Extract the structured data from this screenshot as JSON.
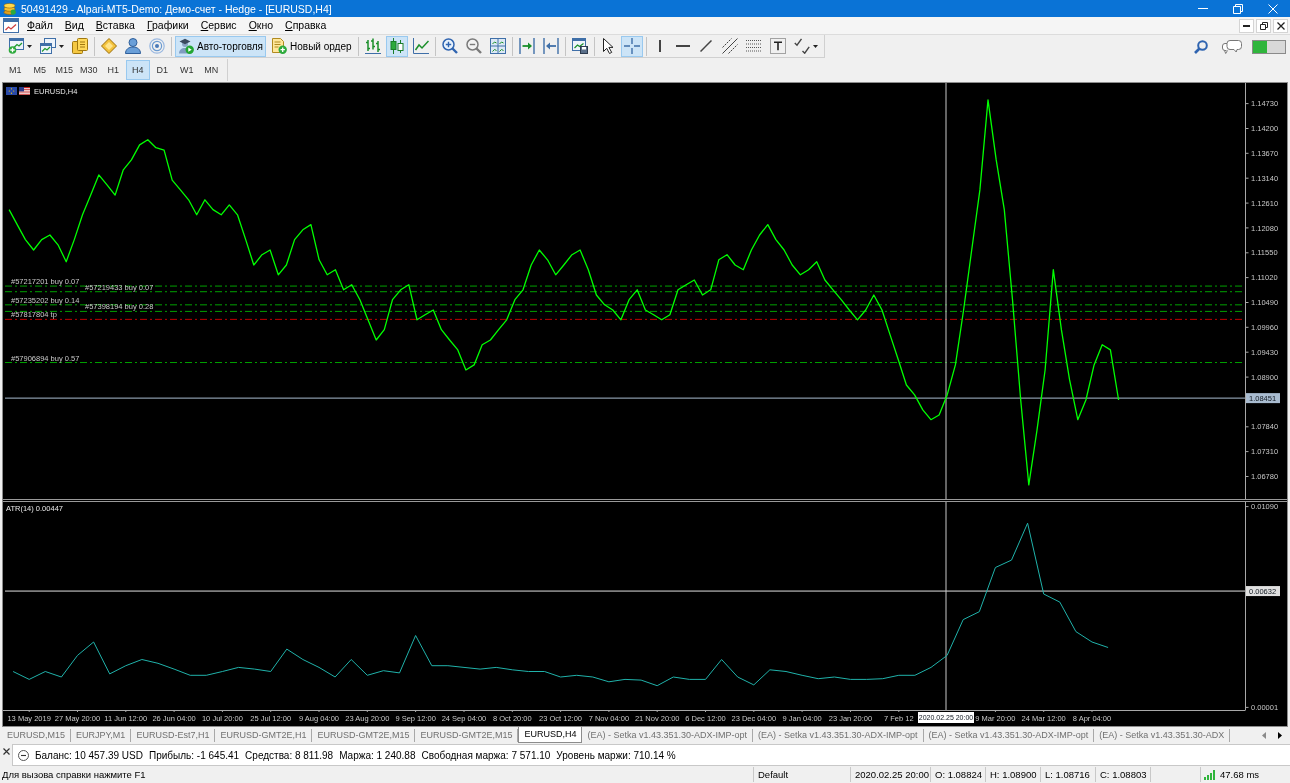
{
  "window": {
    "title": "50491429 - Alpari-MT5-Demo: Демо-счет - Hedge - [EURUSD,H4]"
  },
  "menu": [
    "Файл",
    "Вид",
    "Вставка",
    "Графики",
    "Сервис",
    "Окно",
    "Справка"
  ],
  "toolbar": {
    "auto_trading": {
      "label": "Авто-торговля",
      "on": true
    },
    "new_order": {
      "label": "Новый ордер"
    },
    "chart_types": [
      {
        "selected": false
      },
      {
        "selected": true
      },
      {
        "selected": false
      }
    ],
    "pointer_tools": [
      {
        "selected": false
      },
      {
        "selected": true
      }
    ]
  },
  "timeframes": [
    {
      "label": "M1",
      "selected": false
    },
    {
      "label": "M5",
      "selected": false
    },
    {
      "label": "M15",
      "selected": false
    },
    {
      "label": "M30",
      "selected": false
    },
    {
      "label": "H1",
      "selected": false
    },
    {
      "label": "H4",
      "selected": true
    },
    {
      "label": "D1",
      "selected": false
    },
    {
      "label": "W1",
      "selected": false
    },
    {
      "label": "MN",
      "selected": false
    }
  ],
  "chart": {
    "crosshair": {
      "time_label": "2020.02.25 20:00"
    },
    "chart_data": [
      {
        "type": "line",
        "title": "EURUSD,H4",
        "values": [
          1.1247,
          1.1215,
          1.1183,
          1.1161,
          1.1183,
          1.1193,
          1.1172,
          1.1136,
          1.1183,
          1.1236,
          1.1278,
          1.1321,
          1.13,
          1.1278,
          1.1332,
          1.1353,
          1.1385,
          1.1396,
          1.1379,
          1.1374,
          1.131,
          1.1289,
          1.1268,
          1.1236,
          1.1268,
          1.1247,
          1.1236,
          1.1257,
          1.1236,
          1.1183,
          1.1129,
          1.1151,
          1.1161,
          1.1108,
          1.1129,
          1.1183,
          1.1204,
          1.1215,
          1.114,
          1.1108,
          1.1119,
          1.1076,
          1.1087,
          1.1055,
          1.1012,
          1.0969,
          1.0991,
          1.1055,
          1.1076,
          1.1087,
          1.1012,
          1.1023,
          1.1033,
          1.0991,
          1.0969,
          1.0948,
          1.0905,
          1.0916,
          1.0959,
          1.0969,
          1.0991,
          1.1012,
          1.1055,
          1.1076,
          1.1129,
          1.1161,
          1.114,
          1.1108,
          1.1129,
          1.1151,
          1.1161,
          1.1119,
          1.1065,
          1.1044,
          1.1033,
          1.1012,
          1.1055,
          1.1076,
          1.1033,
          1.1023,
          1.1012,
          1.1023,
          1.1076,
          1.1087,
          1.1097,
          1.1065,
          1.1076,
          1.114,
          1.1151,
          1.1129,
          1.1119,
          1.1161,
          1.1193,
          1.1215,
          1.1183,
          1.1161,
          1.1129,
          1.1108,
          1.1119,
          1.1136,
          1.1097,
          1.1076,
          1.1055,
          1.1033,
          1.1012,
          1.1033,
          1.1065,
          1.1033,
          1.098,
          1.0927,
          1.0873,
          1.0852,
          1.082,
          1.0799,
          1.0809,
          1.0852,
          1.0916,
          1.1033,
          1.1161,
          1.1289,
          1.1481,
          1.1353,
          1.1247,
          1.1055,
          1.0841,
          1.066,
          1.0777,
          1.0905,
          1.1119,
          1.0991,
          1.0884,
          1.0799,
          1.0841,
          1.0916,
          1.0959,
          1.0948,
          1.0841,
          null,
          null,
          null,
          null,
          null,
          null,
          null,
          null,
          null,
          null,
          null,
          null,
          null,
          null,
          null
        ],
        "color": "#00ff00",
        "ylim": [
          1.063,
          1.1517
        ],
        "yticks": [
          {
            "value": 1.1473,
            "label": "1.14730"
          },
          {
            "value": 1.142,
            "label": "1.14200"
          },
          {
            "value": 1.1367,
            "label": "1.13670"
          },
          {
            "value": 1.1314,
            "label": "1.13140"
          },
          {
            "value": 1.1261,
            "label": "1.12610"
          },
          {
            "value": 1.1208,
            "label": "1.12080"
          },
          {
            "value": 1.1155,
            "label": "1.11550"
          },
          {
            "value": 1.1102,
            "label": "1.11020"
          },
          {
            "value": 1.1049,
            "label": "1.10490"
          },
          {
            "value": 1.0996,
            "label": "1.09960"
          },
          {
            "value": 1.0943,
            "label": "1.09430"
          },
          {
            "value": 1.089,
            "label": "1.08900"
          },
          {
            "value": 1.0784,
            "label": "1.07840"
          },
          {
            "value": 1.0731,
            "label": "1.07310"
          },
          {
            "value": 1.0678,
            "label": "1.06780"
          }
        ],
        "tick_labels": "y",
        "ref_lines": [
          {
            "axis": "y",
            "value": 1.1084,
            "label": "#57217201 buy 0.07",
            "color": "#00a000",
            "line_style": "dashdot"
          },
          {
            "axis": "y",
            "value": 1.1072,
            "label": "#57219433 buy 0.07",
            "color": "#00a000",
            "line_style": "dashdot"
          },
          {
            "axis": "y",
            "value": 1.1044,
            "label": "#57235202 buy 0.14",
            "color": "#00a000",
            "line_style": "dashdot"
          },
          {
            "axis": "y",
            "value": 1.103,
            "label": "#57398194 buy 0.28",
            "color": "#00a000",
            "line_style": "dashdot"
          },
          {
            "axis": "y",
            "value": 1.1013,
            "label": "#57817804 tp",
            "color": "#c00000",
            "line_style": "dashdot"
          },
          {
            "axis": "y",
            "value": 1.0921,
            "label": "#57906894 buy 0.57",
            "color": "#00a000",
            "line_style": "dashdot"
          },
          {
            "axis": "y",
            "value": 1.08451,
            "label": "1.08451",
            "color": "#a9bcd0",
            "line_style": "solid"
          }
        ]
      },
      {
        "type": "line",
        "title": "ATR(14) 0.00447",
        "categories": [
          null,
          "13 May 2019",
          null,
          null,
          "27 May 20:00",
          null,
          null,
          "11 Jun 12:00",
          null,
          null,
          "26 Jun 04:00",
          null,
          null,
          "10 Jul 20:00",
          null,
          null,
          "25 Jul 12:00",
          null,
          null,
          "9 Aug 04:00",
          null,
          null,
          "23 Aug 20:00",
          null,
          null,
          "9 Sep 12:00",
          null,
          null,
          "24 Sep 04:00",
          null,
          null,
          "8 Oct 20:00",
          null,
          null,
          "23 Oct 12:00",
          null,
          null,
          "7 Nov 04:00",
          null,
          null,
          "21 Nov 20:00",
          null,
          null,
          "6 Dec 12:00",
          null,
          null,
          "23 Dec 04:00",
          null,
          null,
          "9 Jan 04:00",
          null,
          null,
          "23 Jan 20:00",
          null,
          null,
          "7 Feb 12",
          null,
          null,
          null,
          null,
          null,
          "9 Mar 20:00",
          null,
          null,
          "24 Mar 12:00",
          null,
          null,
          "8 Apr 04:00",
          null,
          null,
          null,
          null,
          null,
          null,
          null,
          null,
          null
        ],
        "values": [
          0.00196,
          0.00153,
          0.00196,
          0.00166,
          0.00283,
          0.00356,
          0.00183,
          0.00227,
          0.00261,
          0.0024,
          0.00209,
          0.00175,
          0.00175,
          0.00196,
          0.00218,
          0.00209,
          0.00196,
          0.00317,
          0.00261,
          0.00218,
          0.00166,
          0.00261,
          0.00175,
          0.002,
          0.00188,
          0.00391,
          0.00227,
          0.00227,
          0.00218,
          0.00209,
          0.00218,
          0.00205,
          0.00196,
          0.00196,
          0.00166,
          0.00175,
          0.00166,
          0.0014,
          0.00153,
          0.00149,
          0.00119,
          0.00166,
          0.00153,
          0.00153,
          0.00261,
          0.00166,
          0.00123,
          0.00205,
          0.00196,
          0.00175,
          0.00157,
          0.00166,
          0.00153,
          0.00153,
          0.00157,
          0.00175,
          0.00175,
          0.00218,
          0.00283,
          0.00477,
          0.0052,
          0.0076,
          0.008,
          0.01,
          0.00616,
          0.00572,
          0.00412,
          0.00356,
          0.00326,
          null,
          null,
          null,
          null,
          null,
          null,
          null,
          null
        ],
        "color": "#20b2aa",
        "ylim": [
          -0.00013,
          0.01115
        ],
        "yticks": [
          {
            "value": 0.0109,
            "label": "0.01090"
          },
          {
            "value": 1e-05,
            "label": "0.00001"
          }
        ],
        "ref_lines": [
          {
            "axis": "y",
            "value": 0.00632,
            "label": "0.00632",
            "color": "#e0e0e0",
            "line_style": "solid"
          }
        ]
      }
    ]
  },
  "chart_tabs": [
    {
      "label": "EURUSD,M15",
      "selected": false
    },
    {
      "label": "EURJPY,M1",
      "selected": false
    },
    {
      "label": "EURUSD-Est7,H1",
      "selected": false
    },
    {
      "label": "EURUSD-GMT2E,H1",
      "selected": false
    },
    {
      "label": "EURUSD-GMT2E,M15",
      "selected": false
    },
    {
      "label": "EURUSD-GMT2E,M15",
      "selected": false
    },
    {
      "label": "EURUSD,H4",
      "selected": true
    },
    {
      "label": "(EA) - Setka v1.43.351.30-ADX-IMP-opt",
      "selected": false
    },
    {
      "label": "(EA) - Setka v1.43.351.30-ADX-IMP-opt",
      "selected": false
    },
    {
      "label": "(EA) - Setka v1.43.351.30-ADX-IMP-opt",
      "selected": false
    },
    {
      "label": "(EA) - Setka v1.43.351.30-ADX",
      "selected": false
    }
  ],
  "account": [
    "Баланс: 10 457.39 USD",
    "Прибыль: -1 645.41",
    "Средства: 8 811.98",
    "Маржа: 1 240.88",
    "Свободная маржа: 7 571.10",
    "Уровень маржи: 710.14 %"
  ],
  "status_bar": {
    "help": "Для вызова справки нажмите F1",
    "profile": "Default",
    "time": "2020.02.25 20:00",
    "ohlc": [
      "O: 1.08824",
      "H: 1.08900",
      "L: 1.08716",
      "C: 1.08803"
    ],
    "ping": "47.68 ms"
  }
}
